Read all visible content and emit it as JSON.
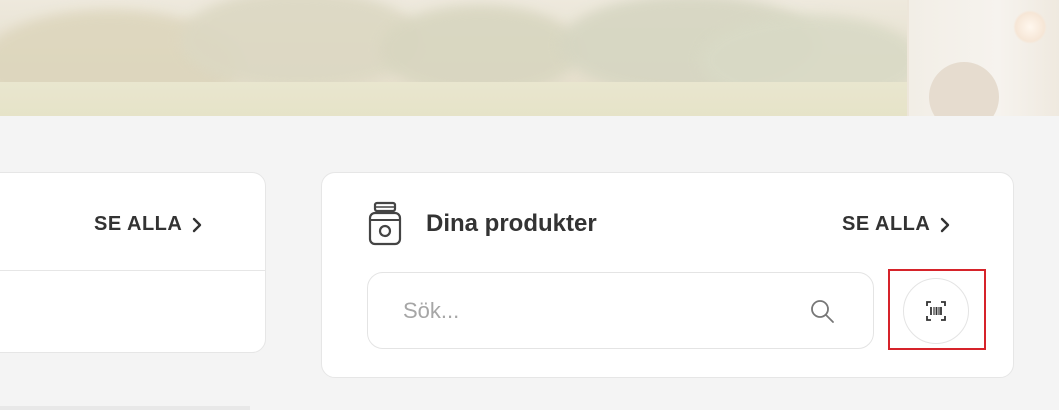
{
  "colors": {
    "background": "#f4f4f4",
    "card": "#ffffff",
    "text": "#333333",
    "placeholder": "#a6a6a6",
    "highlight": "#d6232a"
  },
  "left_card": {
    "see_all_label": "SE ALLA",
    "see_all_icon": "chevron-right-icon"
  },
  "products_card": {
    "icon": "jar-icon",
    "title": "Dina produkter",
    "see_all_label": "SE ALLA",
    "see_all_icon": "chevron-right-icon",
    "search": {
      "placeholder": "Sök...",
      "value": "",
      "icon": "search-icon"
    },
    "scan_button": {
      "icon": "barcode-scan-icon"
    }
  }
}
